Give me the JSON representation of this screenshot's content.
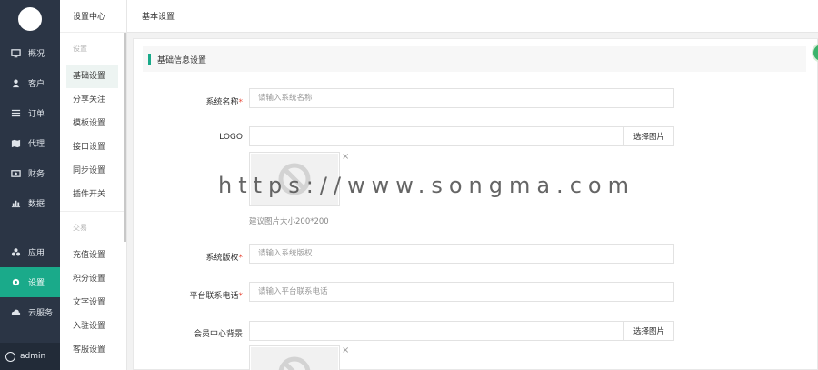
{
  "sidebar": {
    "items": [
      {
        "label": "概况",
        "icon": "monitor-icon"
      },
      {
        "label": "客户",
        "icon": "user-icon"
      },
      {
        "label": "订单",
        "icon": "list-icon"
      },
      {
        "label": "代理",
        "icon": "map-icon"
      },
      {
        "label": "财务",
        "icon": "wallet-icon"
      },
      {
        "label": "数据",
        "icon": "bar-chart-icon"
      },
      {
        "label": "应用",
        "icon": "apps-icon"
      },
      {
        "label": "设置",
        "icon": "gear-icon"
      },
      {
        "label": "云服务",
        "icon": "cloud-icon"
      }
    ],
    "user": "admin",
    "accent": "#1aaa8a"
  },
  "subnav": {
    "title": "设置中心",
    "group1": "设置",
    "group1_items": [
      "基础设置",
      "分享关注",
      "模板设置",
      "接口设置",
      "同步设置",
      "插件开关"
    ],
    "group2": "交易",
    "group2_items": [
      "充值设置",
      "积分设置",
      "文字设置",
      "入驻设置",
      "客服设置"
    ]
  },
  "header": {
    "title": "基本设置"
  },
  "section": {
    "title": "基础信息设置"
  },
  "form": {
    "site_name_label": "系统名称",
    "site_name_placeholder": "请输入系统名称",
    "logo_label": "LOGO",
    "pick_image": "选择图片",
    "logo_hint": "建议图片大小200*200",
    "copyright_label": "系统版权",
    "copyright_placeholder": "请输入系统版权",
    "phone_label": "平台联系电话",
    "phone_placeholder": "请输入平台联系电话",
    "member_bg_label": "会员中心背景",
    "required_mark": "*",
    "close_mark": "×"
  },
  "watermark": "https://www.songma.com"
}
